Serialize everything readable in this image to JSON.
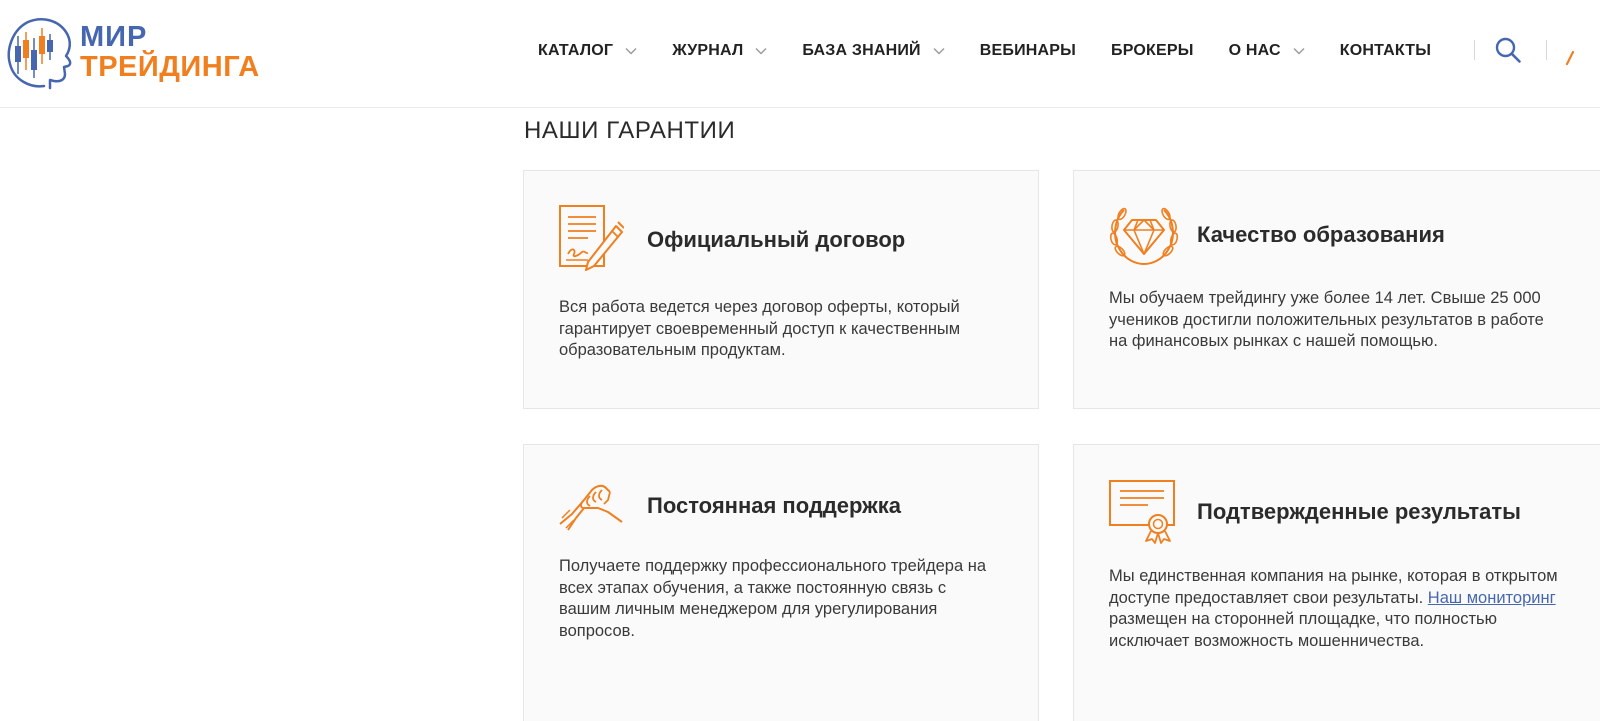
{
  "logo": {
    "line1": "МИР",
    "line2": "ТРЕЙДИНГА",
    "colors": {
      "blue": "#4667b0",
      "orange": "#f07f1f"
    }
  },
  "nav": {
    "items": [
      {
        "label": "КАТАЛОГ",
        "has_dropdown": true
      },
      {
        "label": "ЖУРНАЛ",
        "has_dropdown": true
      },
      {
        "label": "БАЗА ЗНАНИЙ",
        "has_dropdown": true
      },
      {
        "label": "ВЕБИНАРЫ",
        "has_dropdown": false
      },
      {
        "label": "БРОКЕРЫ",
        "has_dropdown": false
      },
      {
        "label": "О НАС",
        "has_dropdown": true
      },
      {
        "label": "КОНТАКТЫ",
        "has_dropdown": false
      }
    ],
    "search_icon": "search-icon"
  },
  "section": {
    "title": "НАШИ ГАРАНТИИ"
  },
  "cards": [
    {
      "icon": "contract-pen-icon",
      "title": "Официальный договор",
      "text": "Вся работа ведется через договор оферты, который гарантирует своевременный доступ к качественным образовательным продуктам."
    },
    {
      "icon": "diamond-laurel-icon",
      "title": "Качество образования",
      "text": "Мы обучаем трейдингу уже более 14 лет. Свыше 25 000 учеников достигли положительных результатов в работе на финансовых рынках с нашей помощью."
    },
    {
      "icon": "handshake-icon",
      "title": "Постоянная поддержка",
      "text": "Получаете поддержку профессионального трейдера на всех этапах обучения, а также постоянную связь с вашим личным менеджером для урегулирования вопросов."
    },
    {
      "icon": "certificate-icon",
      "title": "Подтвержденные результаты",
      "text_before": "Мы единственная компания на рынке, которая в открытом доступе предоставляет свои результаты.",
      "link": "Наш мониторинг",
      "text_after": "размещен на сторонней площадке, что полностью исключает возможность мошенничества."
    }
  ],
  "colors": {
    "accent": "#f07f1f",
    "link": "#4667b0",
    "card_bg": "#fafafa",
    "card_border": "#e6e6e6"
  }
}
